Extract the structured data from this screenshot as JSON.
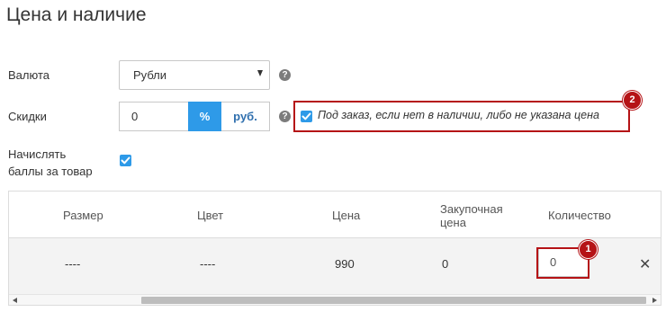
{
  "section": {
    "title": "Цена и наличие"
  },
  "currency": {
    "label": "Валюта",
    "value": "Рубли"
  },
  "discount": {
    "label": "Скидки",
    "value": "0",
    "percent_label": "%",
    "rub_label": "руб."
  },
  "preorder": {
    "label": "Под заказ, если нет в наличии, либо не указана цена",
    "checked": true
  },
  "bonus": {
    "label_line1": "Начислять",
    "label_line2": "баллы за товар",
    "checked": true
  },
  "help_glyph": "?",
  "table": {
    "headers": {
      "size": "Размер",
      "color": "Цвет",
      "price": "Цена",
      "purchase_line1": "Закупочная",
      "purchase_line2": "цена",
      "quantity": "Количество"
    },
    "rows": [
      {
        "size": "----",
        "color": "----",
        "price": "990",
        "purchase": "0",
        "quantity": "0",
        "remove": "✕"
      }
    ]
  },
  "annotations": {
    "badge1": "1",
    "badge2": "2",
    "color": "#b51316"
  },
  "colors": {
    "accent": "#2e9ae8",
    "link": "#2f6fae"
  }
}
